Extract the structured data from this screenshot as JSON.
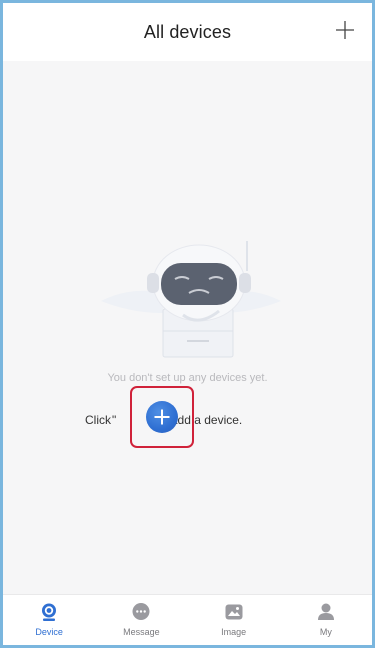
{
  "header": {
    "title": "All devices",
    "add_icon": "plus-icon"
  },
  "empty_state": {
    "message": "You don't set up any devices yet.",
    "hint_prefix": "Click",
    "hint_open_quote": "\"",
    "hint_close_quote": "\"",
    "hint_suffix": "to add a device.",
    "add_icon": "plus-circle-icon",
    "illustration": "robot-illustration"
  },
  "tabs": [
    {
      "label": "Device",
      "icon": "camera-icon",
      "active": true
    },
    {
      "label": "Message",
      "icon": "chat-bubble-icon",
      "active": false
    },
    {
      "label": "Image",
      "icon": "image-icon",
      "active": false
    },
    {
      "label": "My",
      "icon": "person-icon",
      "active": false
    }
  ],
  "colors": {
    "accent": "#2f6fd2",
    "highlight": "#d0223a",
    "inactive": "#7a7a7e"
  }
}
